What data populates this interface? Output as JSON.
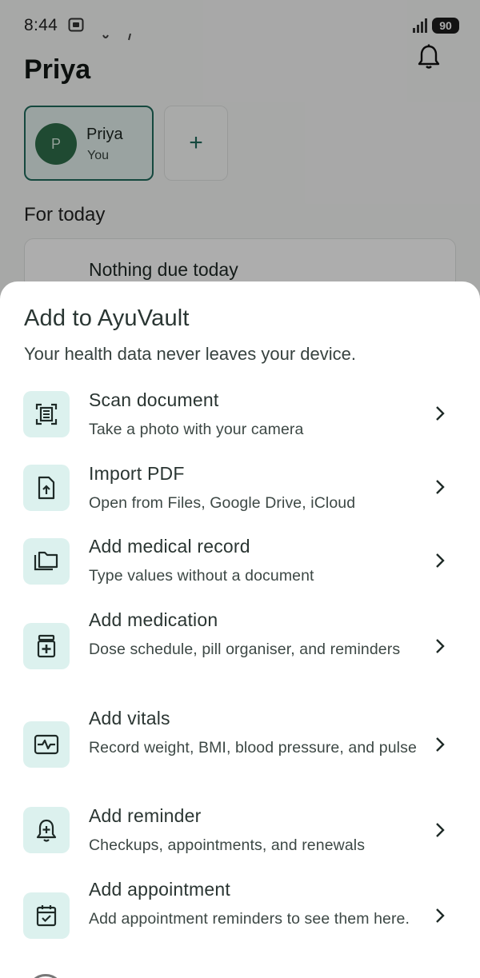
{
  "status_bar": {
    "time": "8:44",
    "battery": "90"
  },
  "header": {
    "profile_name": "Priya",
    "bell_icon": "bell-icon"
  },
  "profiles": {
    "active": {
      "initial": "P",
      "name": "Priya",
      "sub": "You"
    },
    "add_label": "+"
  },
  "today": {
    "title": "For today",
    "empty_text": "Nothing due today"
  },
  "sheet": {
    "title": "Add to AyuVault",
    "subtitle": "Your health data never leaves your device.",
    "options": [
      {
        "icon": "scan-document-icon",
        "title": "Scan document",
        "desc": "Take a photo with your camera"
      },
      {
        "icon": "import-pdf-icon",
        "title": "Import PDF",
        "desc": "Open from Files, Google Drive, iCloud"
      },
      {
        "icon": "folder-icon",
        "title": "Add medical record",
        "desc": "Type values without a document"
      },
      {
        "icon": "medication-icon",
        "title": "Add medication",
        "desc": "Dose schedule, pill organiser, and reminders"
      },
      {
        "icon": "vitals-icon",
        "title": "Add vitals",
        "desc": "Record weight, BMI, blood pressure, and pulse"
      },
      {
        "icon": "reminder-bell-icon",
        "title": "Add reminder",
        "desc": "Checkups, appointments, and renewals"
      },
      {
        "icon": "calendar-check-icon",
        "title": "Add appointment",
        "desc": "Add appointment reminders to see them here."
      }
    ]
  },
  "colors": {
    "accent": "#1f6a5c",
    "icon_tile": "#dcf1ee",
    "avatar": "#2e6e4a"
  }
}
